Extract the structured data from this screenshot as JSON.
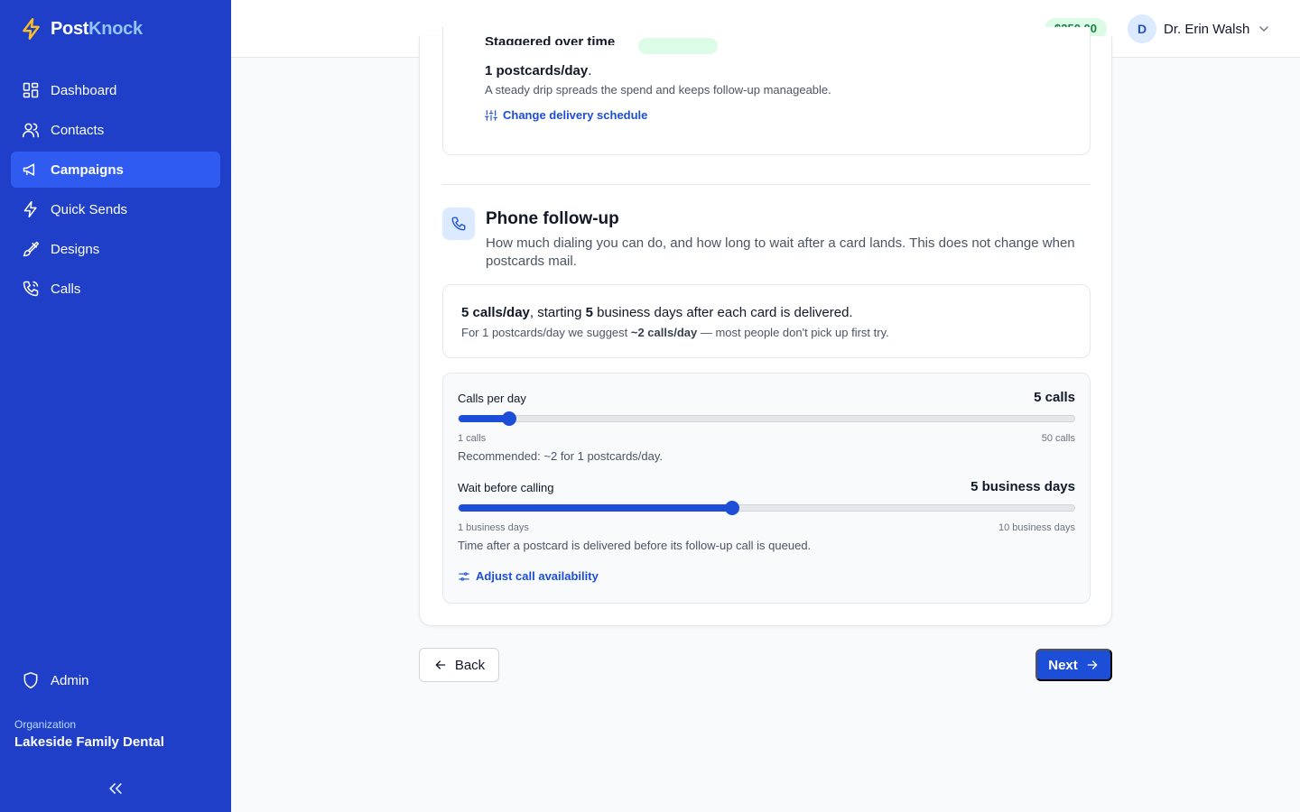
{
  "brand": {
    "part1": "Post",
    "part2": "Knock"
  },
  "sidebar": {
    "items": [
      {
        "label": "Dashboard"
      },
      {
        "label": "Contacts"
      },
      {
        "label": "Campaigns"
      },
      {
        "label": "Quick Sends"
      },
      {
        "label": "Designs"
      },
      {
        "label": "Calls"
      }
    ],
    "active": "Campaigns",
    "admin_label": "Admin",
    "org_label": "Organization",
    "org_name": "Lakeside Family Dental"
  },
  "topbar": {
    "balance": "$250.00",
    "avatar_initial": "D",
    "user_name": "Dr. Erin Walsh"
  },
  "delivery": {
    "partial_title": "Staggered over time",
    "rate_value": "1 postcards/day",
    "rate_suffix": ".",
    "description": "A steady drip spreads the spend and keeps follow-up manageable.",
    "change_link": "Change delivery schedule"
  },
  "phone": {
    "title": "Phone follow-up",
    "description": "How much dialing you can do, and how long to wait after a card lands. This does not change when postcards mail.",
    "summary": {
      "calls": "5 calls/day",
      "part2": ", starting ",
      "days": "5",
      "part3": " business days after each card is delivered."
    },
    "suggest": {
      "part1": "For 1 postcards/day we suggest ",
      "bold": "~2 calls/day",
      "part2": " — most people don't pick up first try."
    },
    "calls_slider": {
      "label": "Calls per day",
      "value_text": "5 calls",
      "value": 5,
      "min": 1,
      "max": 50,
      "min_label": "1 calls",
      "max_label": "50 calls",
      "help": "Recommended: ~2 for 1 postcards/day."
    },
    "wait_slider": {
      "label": "Wait before calling",
      "value_text": "5 business days",
      "value": 5,
      "min": 1,
      "max": 10,
      "min_label": "1 business days",
      "max_label": "10 business days",
      "help": "Time after a postcard is delivered before its follow-up call is queued."
    },
    "availability_link": "Adjust call availability"
  },
  "footer": {
    "back_label": "Back",
    "next_label": "Next"
  },
  "colors": {
    "sidebar": "#1f3fc9",
    "active": "#2f5bf0",
    "accent": "#1d4ed8",
    "balance_bg": "#dcfce7",
    "balance_text": "#15803d"
  }
}
